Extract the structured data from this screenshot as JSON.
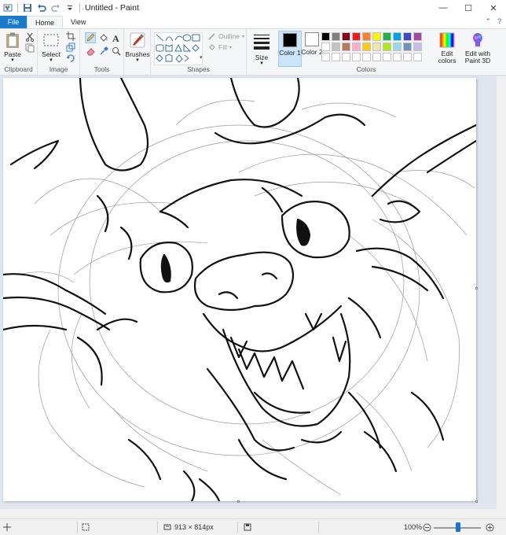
{
  "window": {
    "title": "Untitled - Paint",
    "controls": {
      "minimize": "—",
      "maximize": "☐",
      "close": "✕"
    }
  },
  "ribbon_tabs": [
    {
      "label": "File"
    },
    {
      "label": "Home"
    },
    {
      "label": "View"
    }
  ],
  "groups": {
    "clipboard": {
      "label": "Clipboard",
      "paste_label": "Paste"
    },
    "image": {
      "label": "Image",
      "select_label": "Select"
    },
    "tools": {
      "label": "Tools"
    },
    "brushes": {
      "label": "Brushes"
    },
    "shapes": {
      "label": "Shapes",
      "outline_label": "Outline",
      "fill_label": "Fill"
    },
    "size": {
      "label": "Size"
    },
    "colors": {
      "label": "Colors",
      "color1_label": "Color 1",
      "color2_label": "Color 2",
      "edit_colors_label": "Edit colors",
      "paint3d_label": "Edit with Paint 3D",
      "color1_value": "#000000",
      "color2_value": "#ffffff",
      "palette": [
        "#000000",
        "#7f7f7f",
        "#880015",
        "#ed1c24",
        "#ff7f27",
        "#fff200",
        "#22b14c",
        "#00a2e8",
        "#3f48cc",
        "#a349a4",
        "#ffffff",
        "#c3c3c3",
        "#b97a57",
        "#ffaec9",
        "#ffc90e",
        "#efe4b0",
        "#b5e61d",
        "#99d9ea",
        "#7092be",
        "#c8bfe7",
        "#ffffff",
        "#ffffff",
        "#ffffff",
        "#ffffff",
        "#ffffff",
        "#ffffff",
        "#ffffff",
        "#ffffff",
        "#ffffff",
        "#ffffff"
      ]
    }
  },
  "status": {
    "image_size": "913 × 814px",
    "zoom": "100%"
  },
  "icons": {
    "app": "paint-app-icon",
    "save": "save-icon",
    "undo": "undo-icon",
    "redo": "redo-icon",
    "help": "help-icon"
  },
  "accent_color": "#1979ca"
}
